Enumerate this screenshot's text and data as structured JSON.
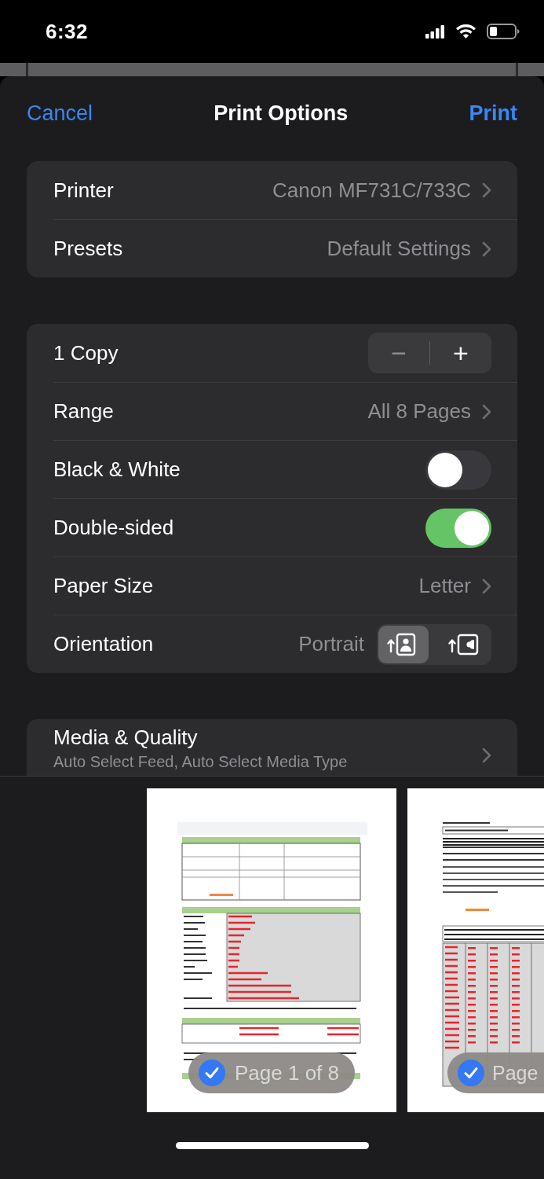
{
  "status_bar": {
    "time": "6:32"
  },
  "nav": {
    "cancel": "Cancel",
    "title": "Print Options",
    "print": "Print"
  },
  "groups": [
    {
      "rows": [
        {
          "kind": "detail",
          "label": "Printer",
          "value": "Canon MF731C/733C"
        },
        {
          "kind": "detail",
          "label": "Presets",
          "value": "Default Settings"
        }
      ]
    },
    {
      "rows": [
        {
          "kind": "stepper",
          "label": "1 Copy",
          "buttons": [
            {
              "text": "−",
              "disabled": true
            },
            {
              "text": "+",
              "disabled": false
            }
          ]
        },
        {
          "kind": "detail",
          "label": "Range",
          "value": "All 8 Pages"
        },
        {
          "kind": "toggle",
          "label": "Black & White",
          "on": false
        },
        {
          "kind": "toggle",
          "label": "Double-sided",
          "on": true
        },
        {
          "kind": "detail",
          "label": "Paper Size",
          "value": "Letter"
        },
        {
          "kind": "orientation",
          "label": "Orientation",
          "value": "Portrait",
          "options": [
            {
              "kind": "portrait",
              "selected": true
            },
            {
              "kind": "landscape",
              "selected": false
            }
          ]
        }
      ]
    },
    {
      "rows": [
        {
          "kind": "detail",
          "label": "Media & Quality",
          "subtitle": "Auto Select Feed, Auto Select Media Type"
        }
      ]
    }
  ],
  "previews": [
    {
      "kind": "picture",
      "badge": {
        "text": "Page 1 of 8",
        "checked": true
      }
    },
    {
      "kind": "picture",
      "badge": {
        "text": "Page",
        "checked": true
      }
    }
  ]
}
